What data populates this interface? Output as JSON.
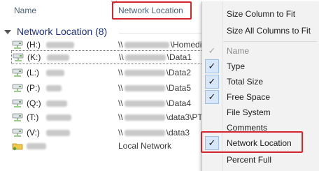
{
  "header": {
    "name_col": "Name",
    "netloc_col": "Network Location"
  },
  "group": {
    "title": "Network Location (8)"
  },
  "rows": [
    {
      "letter": "(H:)",
      "path": "\\\\",
      "path_suffix": "\\Homedi",
      "selected": false
    },
    {
      "letter": "(K:)",
      "path": "\\\\",
      "path_suffix": "\\Data1",
      "selected": true
    },
    {
      "letter": "(L:)",
      "path": "\\\\",
      "path_suffix": "\\Data2",
      "selected": false
    },
    {
      "letter": "(P:)",
      "path": "\\\\",
      "path_suffix": "\\Data5",
      "selected": false
    },
    {
      "letter": "(Q:)",
      "path": "\\\\",
      "path_suffix": "\\Data4",
      "selected": false
    },
    {
      "letter": "(T:)",
      "path": "\\\\",
      "path_suffix": "\\data3\\PT",
      "selected": false
    },
    {
      "letter": "(V:)",
      "path": "\\\\",
      "path_suffix": "\\data3",
      "selected": false
    },
    {
      "letter": "",
      "path": "Local Network",
      "path_suffix": "",
      "selected": false
    }
  ],
  "menu": {
    "items": [
      {
        "label": "Size Column to Fit",
        "check": "none"
      },
      {
        "label": "Size All Columns to Fit",
        "check": "none"
      },
      {
        "label": "Name",
        "check": "disabled"
      },
      {
        "label": "Type",
        "check": "on"
      },
      {
        "label": "Total Size",
        "check": "on"
      },
      {
        "label": "Free Space",
        "check": "on"
      },
      {
        "label": "File System",
        "check": "none"
      },
      {
        "label": "Comments",
        "check": "none"
      },
      {
        "label": "Network Location",
        "check": "on"
      },
      {
        "label": "Percent Full",
        "check": "none"
      }
    ]
  },
  "colors": {
    "highlight_box": "#d6262d",
    "group_title": "#1e3287",
    "check_bg": "#d5e7f8"
  }
}
